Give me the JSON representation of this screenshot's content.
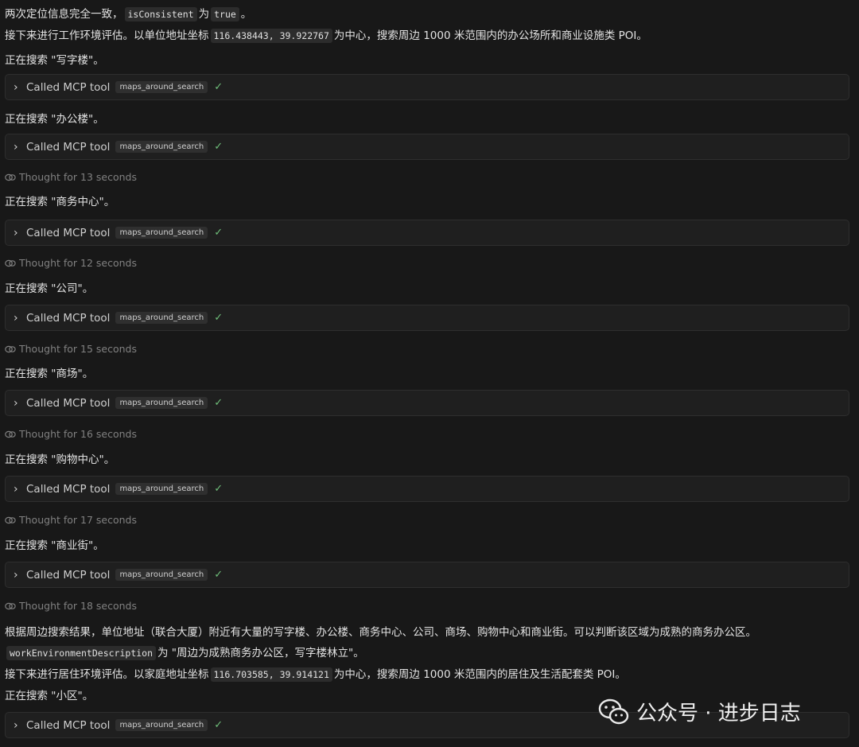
{
  "intro_line_1": {
    "a": "两次定位信息完全一致，",
    "c1": "isConsistent",
    "b": "为",
    "c2": "true",
    "d": "。"
  },
  "intro_line_2": {
    "a": "接下来进行工作环境评估。以单位地址坐标",
    "c1": "116.438443, 39.922767",
    "b": "为中心，搜索周边 1000 米范围内的办公场所和商业设施类 POI。"
  },
  "tool_label": "Called MCP tool",
  "tool_name": "maps_around_search",
  "check": "✓",
  "feed": [
    {
      "kind": "search",
      "text": "正在搜索 \"写字楼\"。"
    },
    {
      "kind": "tool"
    },
    {
      "kind": "search",
      "text": "正在搜索 \"办公楼\"。"
    },
    {
      "kind": "tool"
    },
    {
      "kind": "thought",
      "text": "Thought for 13 seconds"
    },
    {
      "kind": "search",
      "text": "正在搜索 \"商务中心\"。"
    },
    {
      "kind": "tool"
    },
    {
      "kind": "thought",
      "text": "Thought for 12 seconds"
    },
    {
      "kind": "search",
      "text": "正在搜索 \"公司\"。"
    },
    {
      "kind": "tool"
    },
    {
      "kind": "thought",
      "text": "Thought for 15 seconds"
    },
    {
      "kind": "search",
      "text": "正在搜索 \"商场\"。"
    },
    {
      "kind": "tool"
    },
    {
      "kind": "thought",
      "text": "Thought for 16 seconds"
    },
    {
      "kind": "search",
      "text": "正在搜索 \"购物中心\"。"
    },
    {
      "kind": "tool"
    },
    {
      "kind": "thought",
      "text": "Thought for 17 seconds"
    },
    {
      "kind": "search",
      "text": "正在搜索 \"商业街\"。"
    },
    {
      "kind": "tool"
    },
    {
      "kind": "thought",
      "text": "Thought for 18 seconds"
    }
  ],
  "summary_line": "根据周边搜索结果，单位地址（联合大厦）附近有大量的写字楼、办公楼、商务中心、公司、商场、购物中心和商业街。可以判断该区域为成熟的商务办公区。",
  "work_desc": {
    "c1": "workEnvironmentDescription",
    "a": "为 \"周边为成熟商务办公区，写字楼林立\"。"
  },
  "home_line": {
    "a": "接下来进行居住环境评估。以家庭地址坐标",
    "c1": "116.703585, 39.914121",
    "b": "为中心，搜索周边 1000 米范围内的居住及生活配套类 POI。"
  },
  "last_search": "正在搜索 \"小区\"。",
  "watermark": "公众号 · 进步日志",
  "colors": {
    "background": "#181818",
    "check": "#6fbf7a",
    "muted": "#808080"
  }
}
